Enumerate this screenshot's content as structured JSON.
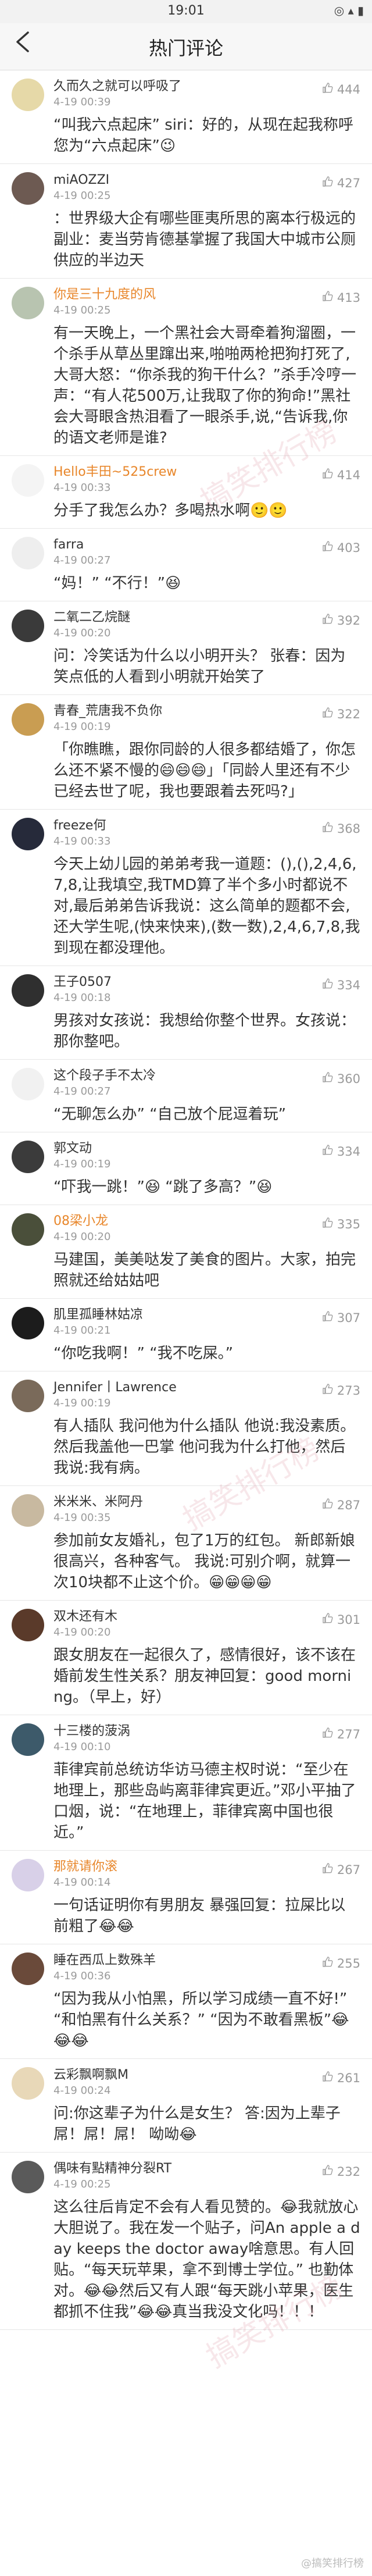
{
  "status_bar": {
    "time": "19:01",
    "icons": "◎ ▴ ▮"
  },
  "nav": {
    "back_icon": "back-arrow-icon",
    "title": "热门评论"
  },
  "watermarks": [
    "搞笑排行榜",
    "搞笑排行榜",
    "搞笑排行榜"
  ],
  "bottom_watermark": "@搞笑排行榜",
  "comments": [
    {
      "name": "久而久之就可以呼吸了",
      "vip": false,
      "time": "4-19 00:39",
      "likes": "444",
      "text": "“叫我六点起床” siri：好的，从现在起我称呼您为“六点起床”😉",
      "avatar_color": "#e6d9a8"
    },
    {
      "name": "miAOZZI",
      "vip": false,
      "time": "4-19 00:25",
      "likes": "427",
      "text": "：世界级大企有哪些匪夷所思的离本行极远的副业：麦当劳肯德基掌握了我国大中城市公厕供应的半边天",
      "avatar_color": "#6d5a52"
    },
    {
      "name": "你是三十九度的风",
      "vip": true,
      "time": "4-19 00:25",
      "likes": "413",
      "text": "有一天晚上，一个黑社会大哥牵着狗溜圈，一个杀手从草丛里蹿出来,啪啪两枪把狗打死了,大哥大怒：“你杀我的狗干什么？”杀手冷哼一声：“有人花500万,让我取了你的狗命!”黑社会大哥眼含热泪看了一眼杀手,说,“告诉我,你的语文老师是谁?",
      "avatar_color": "#b8c4b0"
    },
    {
      "name": "Hello丰田~525crew",
      "vip": true,
      "time": "4-19 00:33",
      "likes": "414",
      "text": "分手了我怎么办？多喝热水啊🙂🙂",
      "avatar_color": "#f4f4f4"
    },
    {
      "name": "farra",
      "vip": false,
      "time": "4-19 00:27",
      "likes": "403",
      "text": "“妈！”   “不行！”😆",
      "avatar_color": "#eeeeee"
    },
    {
      "name": "二氧二乙烷醚",
      "vip": false,
      "time": "4-19 00:20",
      "likes": "392",
      "text": "问：冷笑话为什么以小明开头？ 张春：因为笑点低的人看到小明就开始笑了",
      "avatar_color": "#3a3a3a"
    },
    {
      "name": "青春_荒唐我不负你",
      "vip": false,
      "time": "4-19 00:19",
      "likes": "322",
      "text": "「你瞧瞧，跟你同龄的人很多都结婚了，你怎么还不紧不慢的😄😄😄」「同龄人里还有不少已经去世了呢，我也要跟着去死吗?」",
      "avatar_color": "#c99d52"
    },
    {
      "name": "freeze何",
      "vip": false,
      "time": "4-19 00:33",
      "likes": "368",
      "text": "今天上幼儿园的弟弟考我一道题：(),(),2,4,6,7,8,让我填空,我TMD算了半个多小时都说不对,最后弟弟告诉我说：这么简单的题都不会,还大学生呢,(快来快来),(数一数),2,4,6,7,8,我到现在都没理他。",
      "avatar_color": "#262a3a"
    },
    {
      "name": "王子0507",
      "vip": false,
      "time": "4-19 00:18",
      "likes": "334",
      "text": "男孩对女孩说：我想给你整个世界。女孩说：那你整吧。",
      "avatar_color": "#2f2f2f"
    },
    {
      "name": "这个段子手不太冷",
      "vip": false,
      "time": "4-19 00:27",
      "likes": "360",
      "text": "“无聊怎么办”  “自己放个屁逗着玩”",
      "avatar_color": "#f1f1f1"
    },
    {
      "name": "郭文动",
      "vip": false,
      "time": "4-19 00:19",
      "likes": "334",
      "text": "“吓我一跳！”😆  “跳了多高？”😆",
      "avatar_color": "#3b3b3b"
    },
    {
      "name": "08梁小龙",
      "vip": true,
      "time": "4-19 00:20",
      "likes": "335",
      "text": "马建国，美美哒发了美食的图片。大家，拍完照就还给姑姑吧",
      "avatar_color": "#4a4f3a"
    },
    {
      "name": "肌里孤睡林姑凉",
      "vip": false,
      "time": "4-19 00:21",
      "likes": "307",
      "text": "“你吃我啊！”   “我不吃屎。”",
      "avatar_color": "#1c1c1c"
    },
    {
      "name": "Jennifer丨Lawrence",
      "vip": false,
      "time": "4-19 00:19",
      "likes": "273",
      "text": "有人插队 我问他为什么插队 他说:我没素质。然后我盖他一巴掌 他问我为什么打他，然后我说:我有病。",
      "avatar_color": "#7a6a5a"
    },
    {
      "name": "米米米、米阿丹",
      "vip": false,
      "time": "4-19 00:35",
      "likes": "287",
      "text": "参加前女友婚礼，包了1万的红包。 新郎新娘很高兴，各种客气。 我说:可别介啊，就算一次10块都不止这个价。😁😁😁😁",
      "avatar_color": "#c8b9a0"
    },
    {
      "name": "双木还有木",
      "vip": false,
      "time": "4-19 00:20",
      "likes": "301",
      "text": "跟女朋友在一起很久了，感情很好，该不该在婚前发生性关系？朋友神回复：good morning。（早上，好）",
      "avatar_color": "#5a3a2a"
    },
    {
      "name": "十三楼的菠涡",
      "vip": false,
      "time": "4-19 00:10",
      "likes": "277",
      "text": "菲律宾前总统访华访马德主权时说：“至少在地理上，那些岛屿离菲律宾更近。”邓小平抽了口烟，说：“在地理上，菲律宾离中国也很近。”",
      "avatar_color": "#3d5a6a"
    },
    {
      "name": "那就请你滚",
      "vip": true,
      "time": "4-19 00:14",
      "likes": "267",
      "text": "一句话证明你有男朋友 暴强回复：拉屎比以前粗了😂😂",
      "avatar_color": "#d8d0e8"
    },
    {
      "name": "睡在西瓜上数殊羊",
      "vip": false,
      "time": "4-19 00:36",
      "likes": "255",
      "text": "“因为我从小怕黑，所以学习成绩一直不好!”  “和怕黑有什么关系？”  “因为不敢看黑板”😂😂😂",
      "avatar_color": "#6a4a3a"
    },
    {
      "name": "云彩飘啊飘M",
      "vip": false,
      "time": "4-19 00:24",
      "likes": "261",
      "text": "问:你这辈子为什么是女生？ 答:因为上辈子屌！屌！屌！ 呦呦😂",
      "avatar_color": "#e8d8b8"
    },
    {
      "name": "偶味有點精神分裂RT",
      "vip": false,
      "time": "4-19 00:25",
      "likes": "232",
      "text": "这么往后肯定不会有人看见赞的。😂我就放心大胆说了。我在发一个贴子，问An apple a day keeps the doctor away啥意思。有人回贴。“每天玩苹果，拿不到博士学位。”  也勤体对。😂😂然后又有人跟“每天跳小苹果，医生都抓不住我”😂😂真当我没文化吗！！！",
      "avatar_color": "#5a5a5a"
    }
  ]
}
